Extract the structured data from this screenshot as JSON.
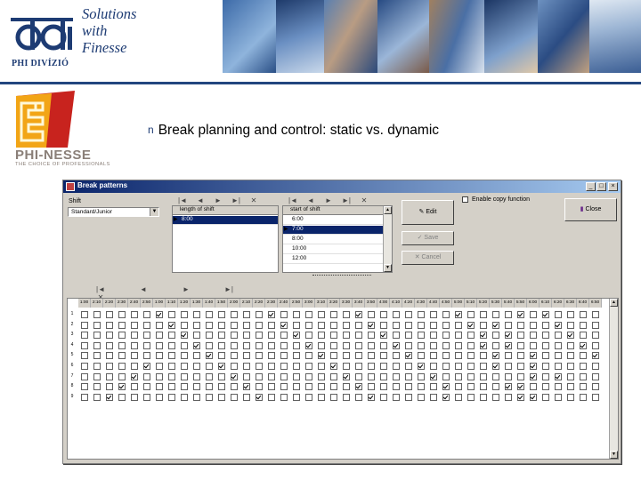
{
  "header": {
    "logo_subtitle": "PHI DIVÍZIÓ",
    "slogan_lines": [
      "Solutions",
      "with",
      "Finesse"
    ]
  },
  "brand": {
    "name": "PHI-NESSE",
    "tagline": "THE CHOICE OF PROFESSIONALS"
  },
  "slide": {
    "bullet": "n",
    "title": "Break planning and control: static vs. dynamic"
  },
  "window": {
    "title": "Break patterns",
    "min_glyph": "_",
    "max_glyph": "□",
    "close_glyph": "×",
    "shift_label": "Shift",
    "shift_value": "Standard/Junior",
    "length_of_shift_header": "length of shift",
    "length_rows": [
      "8:00"
    ],
    "start_of_shift_header": "start of shift",
    "start_rows": [
      "6:00",
      "7:00",
      "8:00",
      "10:00",
      "12:00"
    ],
    "enable_copy_label": "Enable copy function",
    "buttons": {
      "edit": "Edit",
      "save": "Save",
      "cancel": "Cancel",
      "close": "Close"
    },
    "nav_glyphs": [
      "|◄",
      "◄",
      "►",
      "►|",
      "✕"
    ]
  },
  "grid": {
    "times": [
      "1:00",
      "2:10",
      "2:20",
      "2:30",
      "2:40",
      "2:50",
      "1:00",
      "1:10",
      "1:20",
      "1:30",
      "1:40",
      "1:50",
      "2:00",
      "2:10",
      "2:20",
      "2:30",
      "2:40",
      "2:50",
      "3:00",
      "3:10",
      "3:20",
      "3:30",
      "3:40",
      "3:50",
      "4:00",
      "4:10",
      "4:20",
      "4:30",
      "4:40",
      "4:50",
      "5:00",
      "5:10",
      "5:20",
      "5:30",
      "5:40",
      "5:50",
      "6:00",
      "6:10",
      "6:20",
      "6:30",
      "6:40",
      "6:50"
    ],
    "row_labels": [
      "1",
      "2",
      "3",
      "4",
      "5",
      "6",
      "7",
      "8",
      "9"
    ],
    "checked": [
      [
        6,
        15,
        22,
        30,
        35,
        37
      ],
      [
        7,
        16,
        23,
        31,
        33,
        38
      ],
      [
        8,
        17,
        24,
        32,
        34,
        39
      ],
      [
        9,
        18,
        25,
        32,
        34,
        40
      ],
      [
        10,
        19,
        26,
        33,
        36,
        41
      ],
      [
        5,
        11,
        20,
        27,
        33,
        36,
        42
      ],
      [
        4,
        12,
        21,
        28,
        36,
        38
      ],
      [
        3,
        13,
        22,
        29,
        34,
        35
      ],
      [
        2,
        14,
        23,
        29,
        35,
        36
      ]
    ]
  }
}
